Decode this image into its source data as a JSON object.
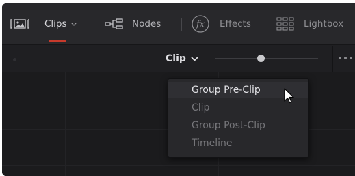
{
  "toolbar": {
    "clips_label": "Clips",
    "nodes_label": "Nodes",
    "effects_label": "Effects",
    "lightbox_label": "Lightbox",
    "effects_icon_text": "fx"
  },
  "subbar": {
    "clip_select_label": "Clip",
    "slider_value": 0.44
  },
  "menu": {
    "items": [
      {
        "label": "Group Pre-Clip",
        "active": true
      },
      {
        "label": "Clip",
        "active": false
      },
      {
        "label": "Group Post-Clip",
        "active": false
      },
      {
        "label": "Timeline",
        "active": false
      }
    ]
  },
  "colors": {
    "accent_red": "#c63a2c",
    "toolbar_bg": "#28282b",
    "panel_bg": "#1b1b1d"
  }
}
